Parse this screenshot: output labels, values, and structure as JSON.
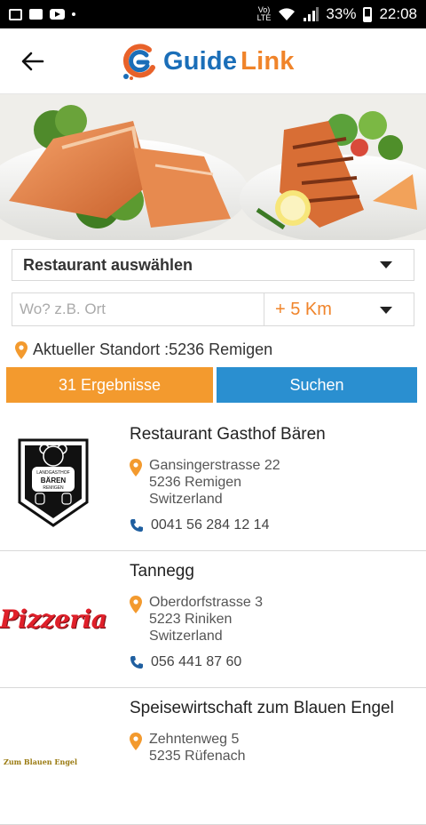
{
  "status_bar": {
    "volte": "Vo)\nLTE",
    "battery": "33%",
    "time": "22:08"
  },
  "header": {
    "logo_guide": "Guide",
    "logo_link": "Link"
  },
  "search": {
    "category_select": "Restaurant auswählen",
    "location_placeholder": "Wo? z.B. Ort",
    "radius": "+ 5 Km",
    "current_location": "Aktueller Standort :5236 Remigen",
    "results_button": "31 Ergebnisse",
    "search_button": "Suchen"
  },
  "results": [
    {
      "name": "Restaurant Gasthof Bären",
      "street": "Gansingerstrasse 22",
      "city": "5236 Remigen",
      "country": "Switzerland",
      "phone": "0041 56 284 12 14",
      "logo_lines": [
        "LANDGASTHOF",
        "BÄREN",
        "REMIGEN"
      ]
    },
    {
      "name": "Tannegg",
      "street": "Oberdorfstrasse 3",
      "city": "5223 Riniken",
      "country": "Switzerland",
      "phone": "056 441 87 60",
      "logo_text": "Pizzeria"
    },
    {
      "name": "Speisewirtschaft zum Blauen Engel",
      "street": "Zehntenweg 5",
      "city": "5235 Rüfenach",
      "country": "",
      "phone": "",
      "logo_text": "Zum Blauen Engel"
    }
  ],
  "colors": {
    "accent_orange": "#f39a2e",
    "accent_blue": "#2a8fd0",
    "logo_blue": "#1a6eb8",
    "logo_orange": "#f0842a"
  }
}
